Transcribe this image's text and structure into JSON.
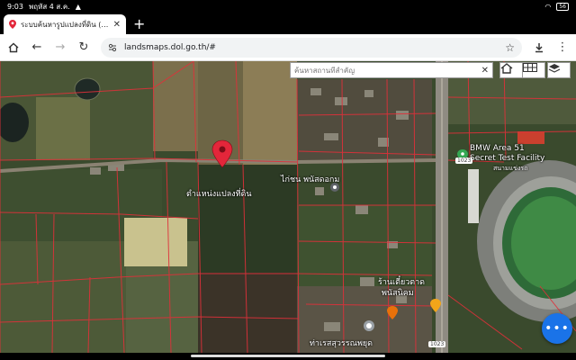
{
  "status": {
    "time": "9:03",
    "date": "พฤหัส 4 ส.ค.",
    "battery": "56"
  },
  "tab": {
    "title": "ระบบค้นหารูปแปลงที่ดิน (LandsMaps)"
  },
  "toolbar": {
    "url": "landsmaps.dol.go.th/#"
  },
  "map": {
    "search_placeholder": "ค้นหาสถานที่สำคัญ",
    "marker_label": "ตำแหน่งแปลงที่ดิน",
    "place_chicken": "ไก่ชน พนัสดอกม",
    "place_bmw": "BMW Area 51",
    "place_bmw_2": "Secret Test Facility",
    "place_stadium": "สนามแข่งรถ",
    "place_market": "ร้านเตี๋ยวตาด",
    "place_market_2": "พนัสนิคม",
    "place_temple": "ท่าเรสสุวรรณพยุด",
    "road_1": "1023",
    "road_2": "1023"
  },
  "colors": {
    "parcel_line": "#e0303a",
    "marker": "#e3263a",
    "fab": "#1a73e8"
  }
}
